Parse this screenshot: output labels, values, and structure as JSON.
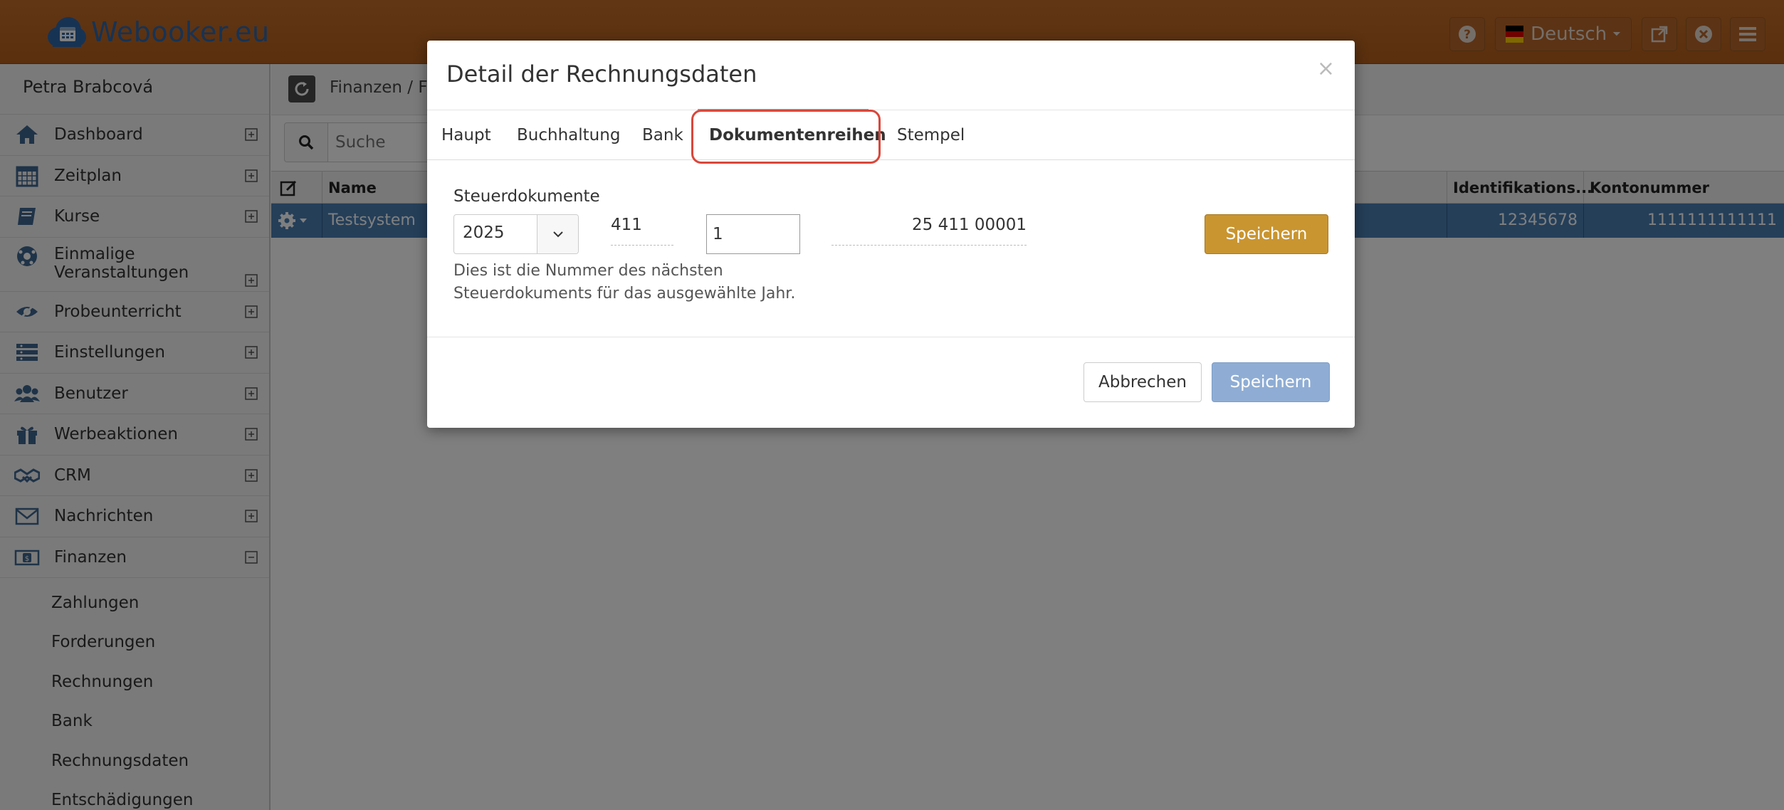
{
  "app": {
    "logo_text": "Webooker.eu",
    "language": "Deutsch"
  },
  "sidebar": {
    "user_name": "Petra Brabcová",
    "items": [
      {
        "label": "Dashboard",
        "icon": "home-icon"
      },
      {
        "label": "Zeitplan",
        "icon": "calendar-icon"
      },
      {
        "label": "Kurse",
        "icon": "book-icon"
      },
      {
        "label": "Einmalige Veranstaltungen",
        "icon": "soccer-ball-icon"
      },
      {
        "label": "Probeunterricht",
        "icon": "eye-icon"
      },
      {
        "label": "Einstellungen",
        "icon": "settings-bars-icon"
      },
      {
        "label": "Benutzer",
        "icon": "users-icon"
      },
      {
        "label": "Werbeaktionen",
        "icon": "gift-icon"
      },
      {
        "label": "CRM",
        "icon": "handshake-icon"
      },
      {
        "label": "Nachrichten",
        "icon": "envelope-icon"
      },
      {
        "label": "Finanzen",
        "icon": "money-icon"
      }
    ],
    "sub_items": [
      "Zahlungen",
      "Forderungen",
      "Rechnungen",
      "Bank",
      "Rechnungsdaten",
      "Entschädigungen"
    ]
  },
  "main": {
    "breadcrumb": "Finanzen / Fa",
    "search_placeholder": "Suche",
    "columns": {
      "name": "Name",
      "identification": "Identifikations...",
      "account": "Kontonummer"
    },
    "row": {
      "name": "Testsystem",
      "identification": "12345678",
      "account": "1111111111111"
    }
  },
  "modal": {
    "title": "Detail der Rechnungsdaten",
    "close": "×",
    "tabs": [
      "Haupt",
      "Buchhaltung",
      "Bank",
      "Dokumentenreihen",
      "Stempel"
    ],
    "field_label": "Steuerdokumente",
    "year": "2025",
    "prefix": "411",
    "number": "1",
    "result": "25 411 00001",
    "save_inline": "Speichern",
    "help_text": "Dies ist die Nummer des nächsten Steuerdokuments für das ausgewählte Jahr.",
    "cancel": "Abbrechen",
    "save": "Speichern"
  }
}
